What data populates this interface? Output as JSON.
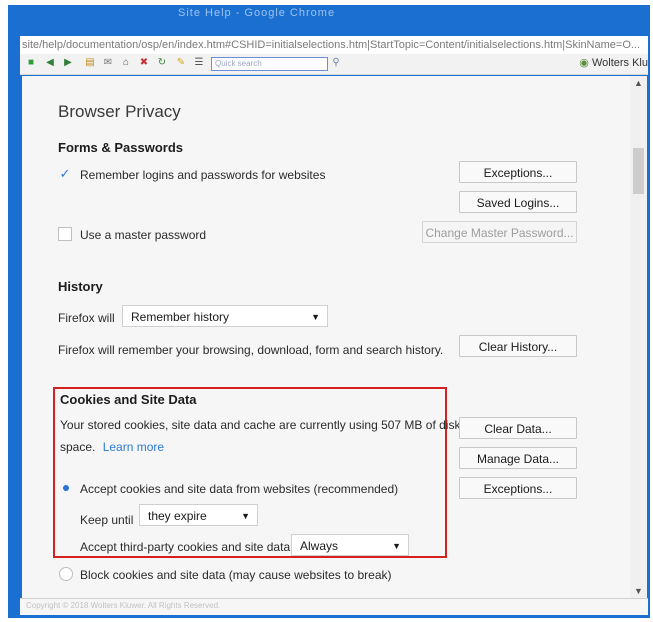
{
  "window": {
    "title": "Site Help - Google Chrome",
    "url": "site/help/documentation/osp/en/index.htm#CSHID=initialselections.htm|StartTopic=Content/initialselections.htm|SkinName=O...",
    "search_placeholder": "Quick search",
    "brand": "Wolters Klu"
  },
  "page": {
    "title": "Browser Privacy",
    "forms": {
      "heading": "Forms & Passwords",
      "remember_label": "Remember logins and passwords for websites",
      "remember_checked": true,
      "exceptions_btn": "Exceptions...",
      "saved_logins_btn": "Saved Logins...",
      "master_label": "Use a master password",
      "master_checked": false,
      "change_master_btn": "Change Master Password..."
    },
    "history": {
      "heading": "History",
      "firefox_will_label": "Firefox will",
      "history_select": "Remember history",
      "description": "Firefox will remember your browsing, download, form and search history.",
      "clear_history_btn": "Clear History..."
    },
    "cookies": {
      "heading": "Cookies and Site Data",
      "usage_text_1": "Your stored cookies, site data and cache are currently using 507 MB of disk",
      "usage_text_2": "space.",
      "learn_more": "Learn more",
      "clear_data_btn": "Clear Data...",
      "manage_data_btn": "Manage Data...",
      "exceptions_btn": "Exceptions...",
      "accept_label": "Accept cookies and site data from websites (recommended)",
      "keep_until_label": "Keep until",
      "keep_until_select": "they expire",
      "third_party_label": "Accept third-party cookies and site data",
      "third_party_select": "Always",
      "block_label": "Block cookies and site data (may cause websites to break)"
    },
    "footer": "Copyright © 2018 Wolters Kluwer. All Rights Reserved."
  },
  "colors": {
    "frame_blue": "#1a6fd0",
    "highlight_red": "#d42020",
    "accent_blue": "#2a73d4"
  }
}
